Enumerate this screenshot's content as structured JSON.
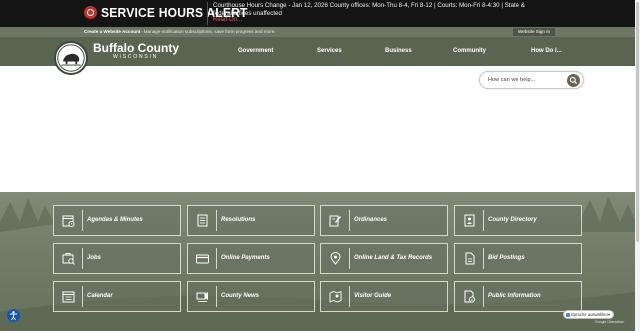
{
  "alert": {
    "title": "SERVICE HOURS ALERT",
    "message": "Courthouse Hours Change - Jan 12, 2026 County offices: Mon-Thu 8-4, Fri 8-12 | Courts: Mon-Fri 8-4:30 | State & federal offices unaffected",
    "read_on": "Read On...",
    "icon": "alert-circle-icon"
  },
  "account": {
    "create_link": "Create a Website Account",
    "description": "- Manage notification subscriptions, save form progress and more.",
    "sign_in": "Website Sign In"
  },
  "header": {
    "county_name": "Buffalo County",
    "state": "WISCONSIN",
    "nav": [
      "Government",
      "Services",
      "Business",
      "Community",
      "How Do I..."
    ]
  },
  "search": {
    "placeholder": "How can we help...",
    "icon": "search-icon"
  },
  "quick_links": [
    {
      "label": "Agendas & Minutes",
      "icon": "calendar-clock-icon"
    },
    {
      "label": "Resolutions",
      "icon": "document-icon"
    },
    {
      "label": "Ordinances",
      "icon": "pen-document-icon"
    },
    {
      "label": "County Directory",
      "icon": "contact-book-icon"
    },
    {
      "label": "Jobs",
      "icon": "briefcase-search-icon"
    },
    {
      "label": "Online Payments",
      "icon": "credit-card-icon"
    },
    {
      "label": "Online Land & Tax Records",
      "icon": "map-pin-icon"
    },
    {
      "label": "Bid Postings",
      "icon": "clipboard-document-icon"
    },
    {
      "label": "Calendar",
      "icon": "calendar-icon"
    },
    {
      "label": "County News",
      "icon": "news-megaphone-icon"
    },
    {
      "label": "Visitor Guide",
      "icon": "map-location-icon"
    },
    {
      "label": "Public Information",
      "icon": "document-info-icon"
    }
  ],
  "translate": {
    "label": "Sprache auswählen",
    "powered_by": "Google Übersetzer"
  },
  "colors": {
    "alert_bar": "#141414",
    "alert_accent": "#c0302e",
    "header": "#5a6551",
    "account_strip": "#6d7766",
    "tile_border": "#d4d8cf"
  }
}
